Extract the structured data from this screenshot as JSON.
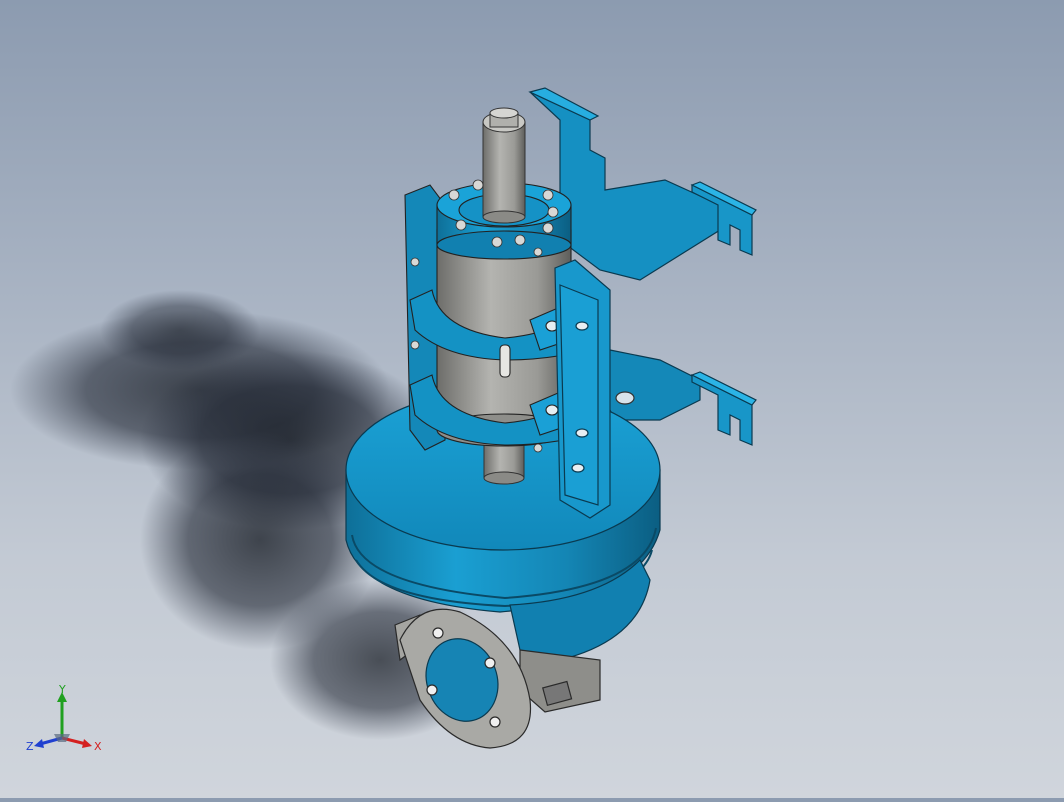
{
  "viewport": {
    "background_top": "#8c9bb0",
    "background_bottom": "#d0d5dc",
    "model_color": "#1596c8",
    "steel_color": "#9a9a96"
  },
  "triad": {
    "x_label": "X",
    "y_label": "Y",
    "z_label": "Z",
    "x_color": "#d42020",
    "y_color": "#20a020",
    "z_color": "#2040d0"
  }
}
